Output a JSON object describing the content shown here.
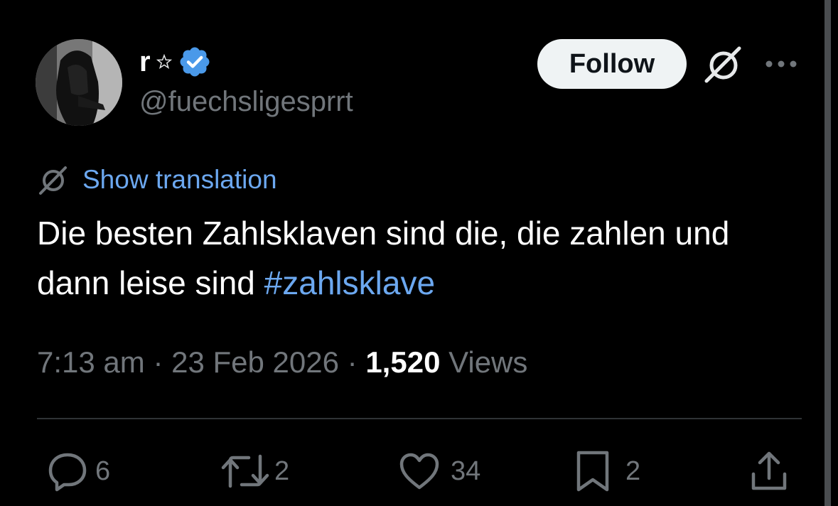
{
  "user": {
    "display_name": "r",
    "handle": "@fuechsligesprrt",
    "verified_color": "#4a99e9"
  },
  "header": {
    "follow_label": "Follow"
  },
  "tweet": {
    "translate_label": "Show translation",
    "text_main": "Die besten Zahlsklaven sind die, die zahlen und dann leise sind ",
    "hashtag": "#zahlsklave",
    "time": "7:13 am",
    "separator": "·",
    "date": "23 Feb 2026",
    "views_count": "1,520",
    "views_label": "Views"
  },
  "actions": {
    "replies": "6",
    "reposts": "2",
    "likes": "34",
    "bookmarks": "2"
  },
  "icons": [
    "star-icon",
    "verified-badge-icon",
    "grok-icon",
    "more-icon",
    "translate-icon",
    "reply-icon",
    "repost-icon",
    "like-icon",
    "bookmark-icon",
    "share-icon"
  ],
  "colors": {
    "background": "#000000",
    "text": "#e7e9ea",
    "secondary": "#71767b",
    "link": "#6ca8f0",
    "follow_bg": "#eff3f4"
  }
}
